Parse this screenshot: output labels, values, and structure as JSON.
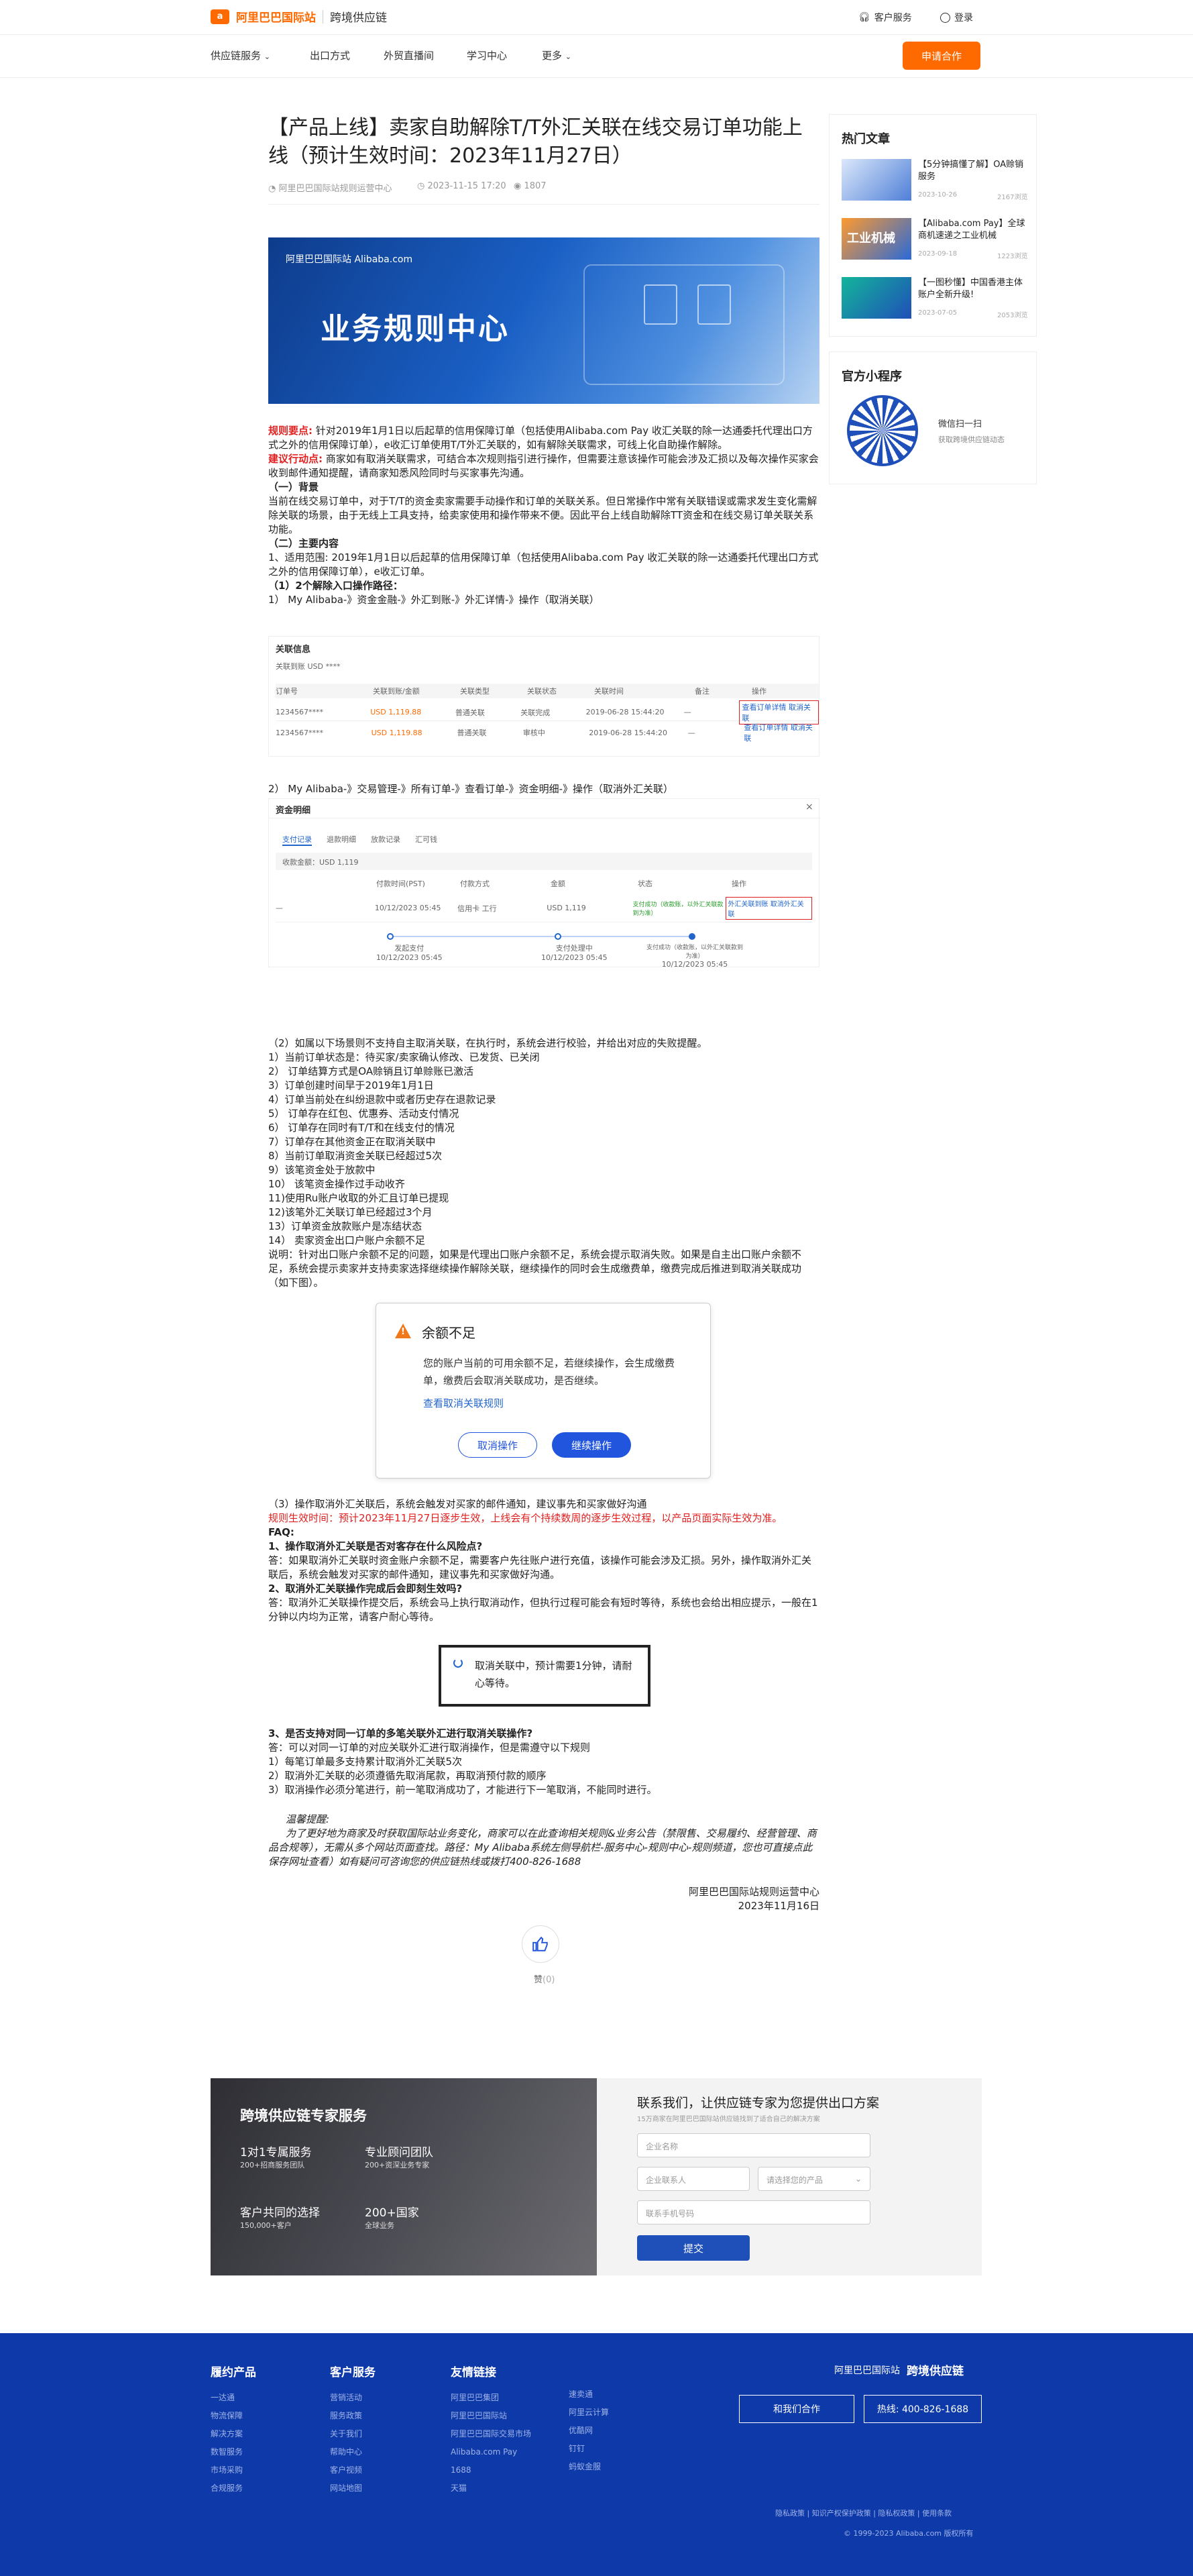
{
  "header": {
    "logo_en": "阿里巴巴国际站",
    "logo_sub": "跨境供应链",
    "customer_service": "客户服务",
    "login": "登录"
  },
  "nav": {
    "items": [
      "供应链服务",
      "出口方式",
      "外贸直播间",
      "学习中心",
      "更多"
    ],
    "apply_button": "申请合作"
  },
  "article": {
    "title": "【产品上线】卖家自助解除T/T外汇关联在线交易订单功能上线（预计生效时间：2023年11月27日）",
    "author": "阿里巴巴国际站规则运营中心",
    "date": "2023-11-15 17:20",
    "views": "1807",
    "banner_brand": "阿里巴巴国际站 Alibaba.com",
    "banner_title": "业务规则中心",
    "rule_label": "规则要点:",
    "rule_text": " 针对2019年1月1日以后起草的信用保障订单（包括使用Alibaba.com Pay 收汇关联的除一达通委托代理出口方式之外的信用保障订单），e收汇订单使用T/T外汇关联的，如有解除关联需求，可线上化自助操作解除。",
    "suggest_label": "建议行动点:",
    "suggest_text": " 商家如有取消关联需求，可结合本次规则指引进行操作，但需要注意该操作可能会涉及汇损以及每次操作买家会收到邮件通知提醒，请商家知悉风险同时与买家事先沟通。",
    "s1_head": "（一）背景",
    "s1_text": "当前在线交易订单中，对于T/T的资金卖家需要手动操作和订单的关联关系。但日常操作中常有关联错误或需求发生变化需解除关联的场景，由于无线上工具支持，给卖家使用和操作带来不便。因此平台上线自助解除TT资金和在线交易订单关联关系功能。",
    "s2_head": "（二）主要内容",
    "s2_p1": "1、适用范围: 2019年1月1日以后起草的信用保障订单（包括使用Alibaba.com Pay 收汇关联的除一达通委托代理出口方式之外的信用保障订单），e收汇订单。",
    "s2_p2": "（1）2个解除入口操作路径：",
    "s2_p3": "1） My Alibaba-》资金金融-》外汇到账-》外汇详情-》操作（取消关联）",
    "s2_p4": "2） My Alibaba-》交易管理-》所有订单-》查看订单-》资金明细-》操作（取消外汇关联）",
    "s2_fail_head": "（2）如属以下场景则不支持自主取消关联，在执行时，系统会进行校验，并给出对应的失败提醒。",
    "fail_items": [
      "1）当前订单状态是：待买家/卖家确认修改、已发货、已关闭",
      "2） 订单结算方式是OA赊销且订单赊账已激活",
      "3）订单创建时间早于2019年1月1日",
      "4）订单当前处在纠纷退款中或者历史存在退款记录",
      "5） 订单存在红包、优惠券、活动支付情况",
      "6） 订单存在同时有T/T和在线支付的情况",
      "7）订单存在其他资金正在取消关联中",
      "8）当前订单取消资金关联已经超过5次",
      "9）该笔资金处于放款中",
      "10） 该笔资金操作过手动收齐",
      "11)使用Ru账户收取的外汇且订单已提现",
      "12)该笔外汇关联订单已经超过3个月",
      "13）订单资金放款账户是冻结状态",
      "14） 卖家资金出口户账户余额不足"
    ],
    "note_text": "说明：针对出口账户余额不足的问题，如果是代理出口账户余额不足，系统会提示取消失败。如果是自主出口账户余额不足，系统会提示卖家并支持卖家选择继续操作解除关联，继续操作的同时会生成缴费单，缴费完成后推进到取消关联成功（如下图）。",
    "modal_title": "余额不足",
    "modal_body": "您的账户当前的可用余额不足，若继续操作，会生成缴费单，缴费后会取消关联成功，是否继续。",
    "modal_link": "查看取消关联规则",
    "modal_cancel": "取消操作",
    "modal_continue": "继续操作",
    "s3_text": "（3）操作取消外汇关联后，系统会触发对买家的邮件通知，建议事先和买家做好沟通",
    "effective_text": "规则生效时间：预计2023年11月27日逐步生效，上线会有个持续数周的逐步生效过程，以产品页面实际生效为准。",
    "faq_head": "FAQ:",
    "faq1_q": "1、操作取消外汇关联是否对客存在什么风险点?",
    "faq1_a": "答：如果取消外汇关联时资金账户余额不足，需要客户先往账户进行充值，该操作可能会涉及汇损。另外，操作取消外汇关联后，系统会触发对买家的邮件通知，建议事先和买家做好沟通。",
    "faq2_q": "2、取消外汇关联操作完成后会即刻生效吗?",
    "faq2_a": "答：取消外汇关联操作提交后，系统会马上执行取消动作，但执行过程可能会有短时等待，系统也会给出相应提示，一般在1分钟以内均为正常，请客户耐心等待。",
    "toast_text": "取消关联中，预计需要1分钟，请耐心等待。",
    "faq3_q": "3、是否支持对同一订单的多笔关联外汇进行取消关联操作?",
    "faq3_a": "答：可以对同一订单的对应关联外汇进行取消操作，但是需遵守以下规则",
    "faq3_items": [
      "1）每笔订单最多支持累计取消外汇关联5次",
      "2）取消外汇关联的必须遵循先取消尾款，再取消预付款的顺序",
      "3）取消操作必须分笔进行，前一笔取消成功了，才能进行下一笔取消，不能同时进行。"
    ],
    "reminder_head": "温馨提醒:",
    "reminder_text": "为了更好地为商家及时获取国际站业务变化，商家可以在此查询相关规则&业务公告（禁限售、交易履约、经营管理、商品合规等），无需从多个网站页面查找。路径：My Alibaba系统左侧导航栏-服务中心-规则中心-规则频道，您也可直接点此保存网址查看）如有疑问可咨询您的供应链热线或拨打400-826-1688",
    "signature": "阿里巴巴国际站规则运营中心",
    "sign_date": "2023年11月16日",
    "like_label": "赞",
    "like_count": "(0)"
  },
  "shot1": {
    "title": "关联信息",
    "headers": [
      "订单号",
      "关联到账/金额",
      "关联类型",
      "关联状态",
      "关联时间",
      "备注",
      "操作"
    ],
    "rows": [
      [
        "1234567****",
        "USD 1,119.88",
        "普通关联",
        "关联完成",
        "2019-06-28 15:44:20",
        "—",
        "查看订单详情 取消关联"
      ],
      [
        "1234567****",
        "USD 1,119.88",
        "普通关联",
        "审核中",
        "2019-06-28 15:44:20",
        "—",
        "查看订单详情 取消关联"
      ]
    ]
  },
  "shot2": {
    "title": "资金明细",
    "tabs": [
      "支付记录",
      "退款明细",
      "放款记录",
      "汇可钱"
    ],
    "summary": "收款金额：USD 1,119",
    "headers": [
      "",
      "付款时间(PST)",
      "付款方式",
      "金额",
      "状态",
      "操作"
    ],
    "row": [
      "—",
      "10/12/2023 05:45",
      "信用卡 工行",
      "USD 1,119",
      "支付成功（收款账，以外汇关联款到为准）",
      "外汇关联到账 取消外汇关联"
    ],
    "steps": [
      {
        "label": "发起支付",
        "time": "10/12/2023 05:45"
      },
      {
        "label": "支付处理中",
        "time": "10/12/2023 05:45"
      },
      {
        "label": "支付成功（收款账，以外汇关联款到为准）",
        "time": "10/12/2023 05:45"
      }
    ]
  },
  "sidebar": {
    "hot_title": "热门文章",
    "hot": [
      {
        "title": "【5分钟搞懂了解】OA赊销服务",
        "date": "2023-10-26",
        "views": "2167浏览"
      },
      {
        "title": "【Alibaba.com Pay】全球商机速递之工业机械",
        "date": "2023-09-18",
        "views": "1223浏览"
      },
      {
        "title": "【一图秒懂】中国香港主体账户全新升级!",
        "date": "2023-07-05",
        "views": "2053浏览"
      }
    ],
    "mini_title": "官方小程序",
    "mini_scan": "微信扫一扫",
    "mini_desc": "获取跨境供应链动态"
  },
  "promo": {
    "heading": "跨境供应链专家服务",
    "features": [
      {
        "title": "1对1专属服务",
        "sub": "200+招商服务团队"
      },
      {
        "title": "专业顾问团队",
        "sub": "200+资深业务专家"
      },
      {
        "title": "客户共同的选择",
        "sub": "150,000+客户"
      },
      {
        "title": "200+国家",
        "sub": "全球业务"
      }
    ],
    "form_title": "联系我们，让供应链专家为您提供出口方案",
    "form_sub": "15万商家在阿里巴巴国际站供应链找到了适合自己的解决方案",
    "company_placeholder": "企业名称",
    "contact_placeholder": "企业联系人",
    "need_placeholder": "请选择您的产品",
    "phone_placeholder": "联系手机号码",
    "submit": "提交"
  },
  "footer": {
    "cols": [
      {
        "title": "履约产品",
        "items": [
          "一达通",
          "物流保障",
          "解决方案",
          "数智服务",
          "市场采购",
          "合规服务"
        ]
      },
      {
        "title": "客户服务",
        "items": [
          "营销活动",
          "服务政策",
          "关于我们",
          "帮助中心",
          "客户视频",
          "网站地图"
        ]
      },
      {
        "title": "友情链接",
        "items": [
          "阿里巴巴集团",
          "阿里巴巴国际站",
          "阿里巴巴国际交易市场",
          "Alibaba.com Pay",
          "1688",
          "天猫"
        ]
      },
      {
        "title": "",
        "items": [
          "速卖通",
          "阿里云计算",
          "优酷网",
          "钉钉",
          "蚂蚁金服"
        ]
      }
    ],
    "brand": "跨境供应链",
    "cooperate_btn": "和我们合作",
    "hotline_btn": "热线: 400-826-1688",
    "legal": "隐私政策 | 知识产权保护政策 | 隐私权政策 | 使用条款",
    "copyright": "© 1999-2023 Alibaba.com 版权所有"
  }
}
